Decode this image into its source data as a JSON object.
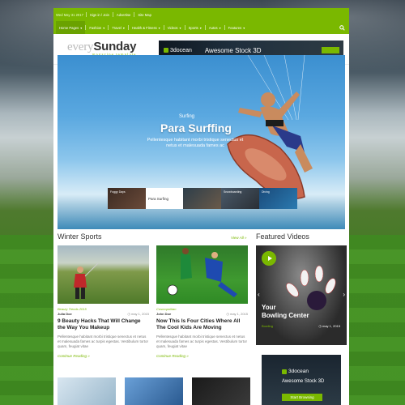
{
  "topnav": {
    "date": "Wed May 31 2017",
    "items": [
      "Sign in / Join",
      "Advertise",
      "Site Map"
    ],
    "menu": [
      "Home Pages",
      "Fashion",
      "Travel",
      "Health & Fitness",
      "Videos",
      "Sports",
      "Autos",
      "Features"
    ]
  },
  "logo": {
    "part1": "every",
    "part2": "Sunday",
    "tagline": "magazine template"
  },
  "banner": {
    "brand": "3docean",
    "text": "Awesome Stock 3D"
  },
  "hero": {
    "category": "Surfing",
    "title": "Para Surffing",
    "desc": "Pellentesque habitant morbi tristique senectus et netus et malesuada fames ac",
    "active_thumb": "Para Surfing",
    "thumb_captions": [
      "Foggy Days",
      "",
      "Snowboarding",
      "Diving"
    ]
  },
  "winter": {
    "title": "Winter Sports",
    "view_all": "View All »"
  },
  "cards": [
    {
      "category": "Beauty Trends 2015",
      "author": "Julia Doe",
      "date": "may 1, 2015",
      "headline": "9 Beauty Hacks That Will Change the Way You Makeup",
      "excerpt": "Pellentesque habitant morbi tristique senectus et netus et malesuada fames ac turpis egestas. Vestibulum tortor quam, feugiat vitae",
      "more": "Continue Reading »"
    },
    {
      "category": "Cosmopolitan",
      "author": "John Doe",
      "date": "may 1, 2015",
      "headline": "Now This Is Four Cities Where All The Cool Kids Are Moving",
      "excerpt": "Pellentesque habitant morbi tristique senectus et netus et malesuada fames ac turpis egestas. Vestibulum tortor quam, feugiat vitae",
      "more": "Continue Reading »"
    }
  ],
  "videos": {
    "title": "Featured Videos",
    "video_title_1": "Your",
    "video_title_2": "Bowling Center",
    "category": "Bowling",
    "date": "may 1, 2015"
  },
  "ad2": {
    "brand": "3docean",
    "text": "Awesome Stock 3D",
    "button": "Start Browsing"
  },
  "colors": {
    "accent": "#7ab800"
  }
}
